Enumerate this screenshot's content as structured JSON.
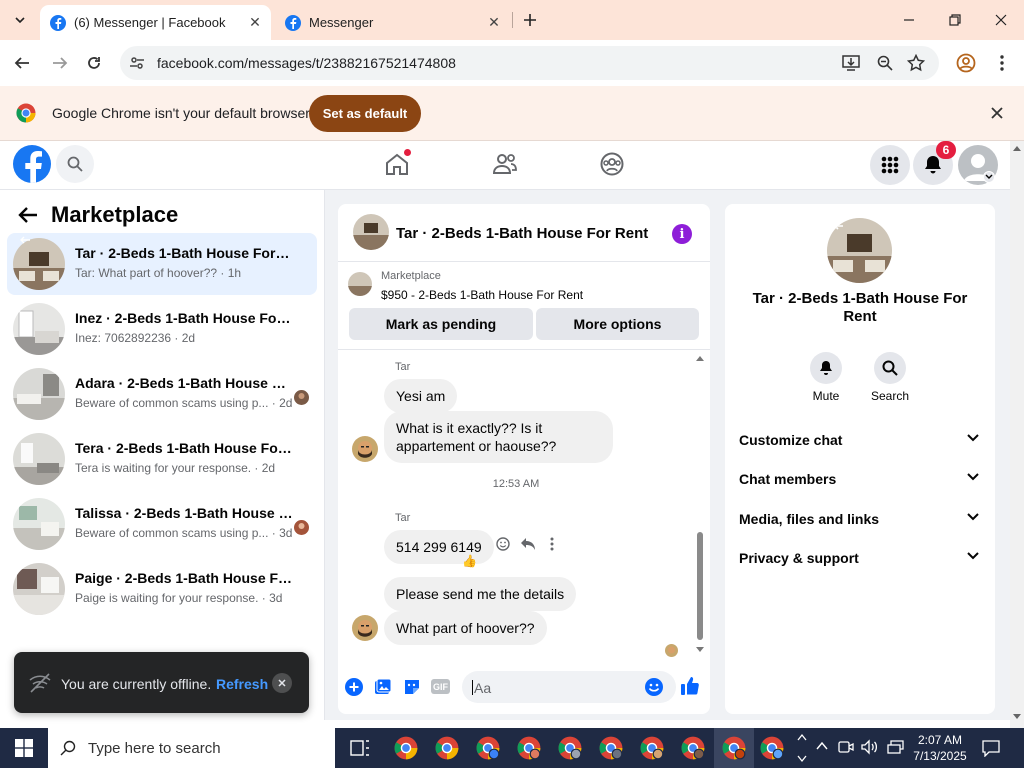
{
  "browser": {
    "tabs": [
      {
        "title": "(6) Messenger | Facebook",
        "active": true
      },
      {
        "title": "Messenger",
        "active": false
      }
    ],
    "url": "facebook.com/messages/t/23882167521474808",
    "infobar_text": "Google Chrome isn't your default browser",
    "set_default_label": "Set as default"
  },
  "fb": {
    "notification_count": "6"
  },
  "marketplace": {
    "title": "Marketplace",
    "conversations": [
      {
        "name": "Tar · 2-Beds 1-Bath House For Rent",
        "preview": "Tar: What part of hoover?? · 1h",
        "selected": true
      },
      {
        "name": "Inez · 2-Beds 1-Bath House For Rent",
        "preview": "Inez: 7062892236 · 2d",
        "selected": false
      },
      {
        "name": "Adara · 2-Beds 1-Bath House For...",
        "preview": "Beware of common scams using p... · 2d",
        "selected": false
      },
      {
        "name": "Tera · 2-Beds 1-Bath House For Rent",
        "preview": "Tera is waiting for your response. · 2d",
        "selected": false
      },
      {
        "name": "Talissa · 2-Beds 1-Bath House Fo...",
        "preview": "Beware of common scams using p... · 3d",
        "selected": false
      },
      {
        "name": "Paige · 2-Beds 1-Bath House For R...",
        "preview": "Paige is waiting for your response. · 3d",
        "selected": false
      }
    ]
  },
  "toast": {
    "text": "You are currently offline.",
    "refresh_label": "Refresh"
  },
  "chat": {
    "title": "Tar · 2-Beds 1-Bath House For Rent",
    "listing_source": "Marketplace",
    "listing_title": "$950 - 2-Beds 1-Bath House For Rent",
    "pending_label": "Mark as pending",
    "more_label": "More options",
    "messages": {
      "sender1": "Tar",
      "msg1": "Yesi am",
      "msg2": "What is it exactly?? Is it appartement or haouse??",
      "time": "12:53 AM",
      "sender2": "Tar",
      "msg3": "514 299 6149",
      "msg4": "Please send me the details",
      "msg5": "What part of hoover??"
    },
    "input_placeholder": "Aa"
  },
  "rightpanel": {
    "title": "Tar · 2-Beds 1-Bath House For Rent",
    "mute_label": "Mute",
    "search_label": "Search",
    "sections": [
      "Customize chat",
      "Chat members",
      "Media, files and links",
      "Privacy & support"
    ]
  },
  "taskbar": {
    "search_placeholder": "Type here to search",
    "time": "2:07 AM",
    "date": "7/13/2025"
  },
  "colors": {
    "fb_blue": "#1877f2",
    "chrome_tab_bg": "#fde4d8",
    "set_default_btn": "#8b4513",
    "info_purple": "#8e1ed8",
    "badge_red": "#e41e3f"
  }
}
